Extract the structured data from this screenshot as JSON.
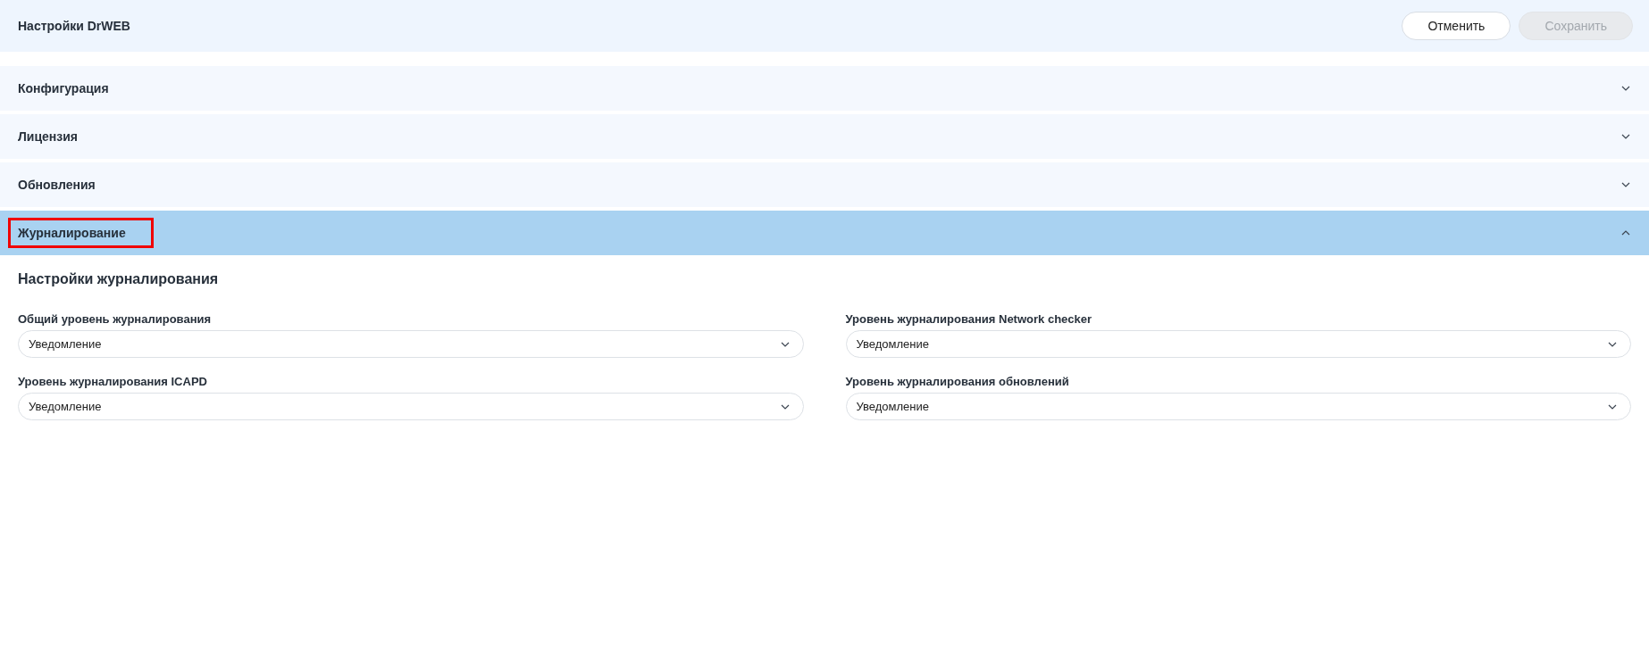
{
  "header": {
    "title": "Настройки DrWEB",
    "buttons": [
      {
        "label": "Отменить",
        "disabled": false
      },
      {
        "label": "Сохранить",
        "disabled": true
      }
    ]
  },
  "sections": [
    {
      "title": "Конфигурация",
      "expanded": false,
      "highlighted": false
    },
    {
      "title": "Лицензия",
      "expanded": false,
      "highlighted": false
    },
    {
      "title": "Обновления",
      "expanded": false,
      "highlighted": false
    },
    {
      "title": "Журналирование",
      "expanded": true,
      "highlighted": true,
      "heading": "Настройки журналирования",
      "fields": [
        {
          "label": "Общий уровень журналирования",
          "value": "Уведомление"
        },
        {
          "label": "Уровень журналирования Network checker",
          "value": "Уведомление"
        },
        {
          "label": "Уровень журналирования ICAPD",
          "value": "Уведомление"
        },
        {
          "label": "Уровень журналирования обновлений",
          "value": "Уведомление"
        }
      ]
    }
  ]
}
